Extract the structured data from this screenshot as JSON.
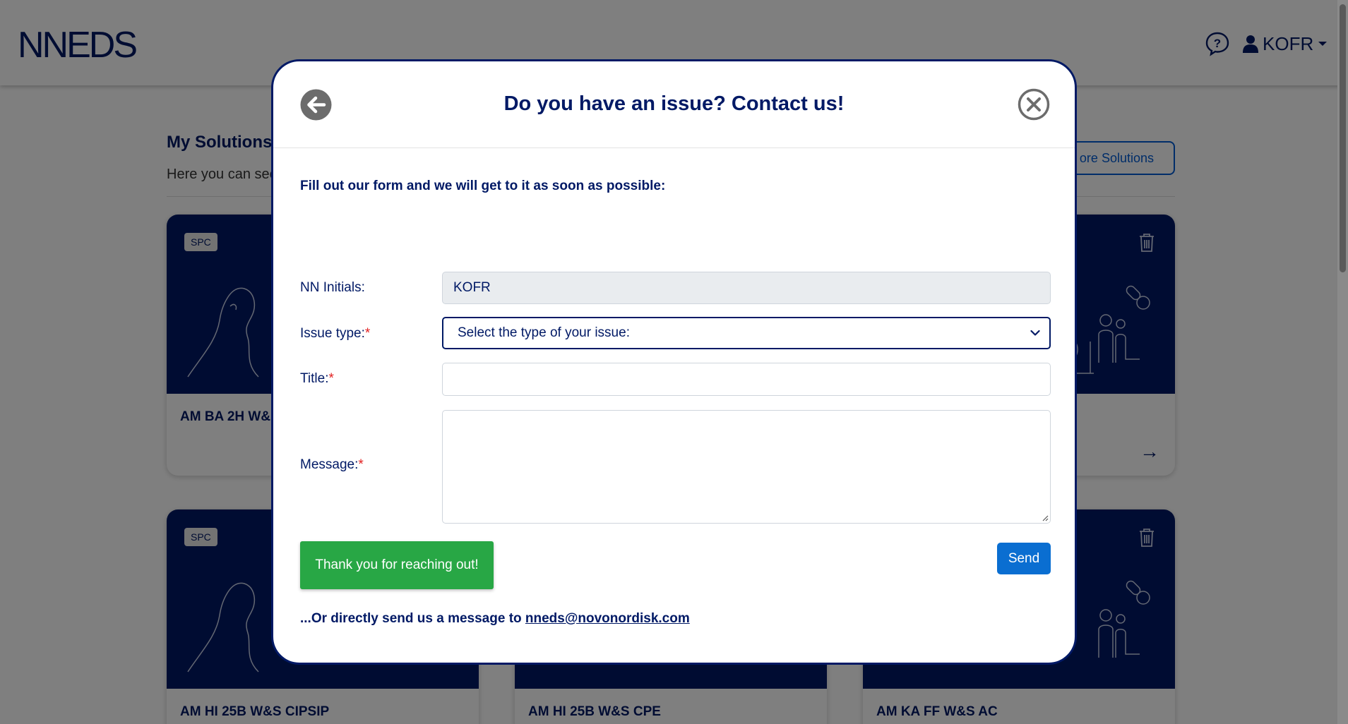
{
  "app": {
    "logo": "NNEDS",
    "user_initials": "KOFR"
  },
  "page": {
    "section_title": "My Solutions",
    "section_subtitle": "Here you can see",
    "more_solutions_button": "ore Solutions"
  },
  "cards": [
    {
      "badge": "SPC",
      "title": "AM BA 2H W&"
    },
    {
      "badge": "SPC",
      "title": "AM HI 25B W&S CIPSIP"
    },
    {
      "badge": "",
      "title": "AM HI 25B W&S CPE"
    },
    {
      "badge": "",
      "title": "AM KA FF W&S AC"
    }
  ],
  "modal": {
    "title": "Do you have an issue? Contact us!",
    "intro": "Fill out our form and we will get to it as soon as possible:",
    "fields": {
      "initials_label": "NN Initials:",
      "initials_value": "KOFR",
      "issue_type_label": "Issue type:",
      "issue_type_value": "Select the type of your issue:",
      "title_label": "Title:",
      "title_value": "",
      "message_label": "Message:",
      "message_value": ""
    },
    "required_marker": "*",
    "thanks_message": "Thank you for reaching out!",
    "send_button": "Send",
    "direct_text": "...Or directly send us a message to ",
    "direct_email": "nneds@novonordisk.com"
  },
  "colors": {
    "brand_navy": "#001965",
    "success_green": "#28a745",
    "primary_blue": "#0a6ed1",
    "required_red": "#e22020"
  }
}
